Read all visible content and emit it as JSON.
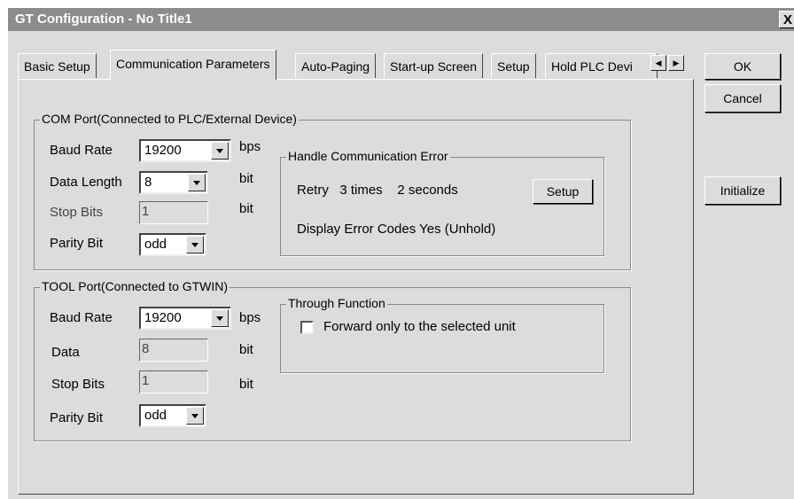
{
  "window": {
    "title": "GT Configuration - No Title1",
    "close_label": "X"
  },
  "tabs": [
    {
      "label": "Basic Setup"
    },
    {
      "label": "Communication Parameters"
    },
    {
      "label": "Auto-Paging"
    },
    {
      "label": "Start-up Screen"
    },
    {
      "label": "Setup"
    },
    {
      "label": "Hold PLC Devi"
    }
  ],
  "tab_scroll": {
    "left": "◀",
    "right": "▶"
  },
  "buttons": {
    "ok": "OK",
    "cancel": "Cancel",
    "initialize": "Initialize"
  },
  "com_port": {
    "legend": "COM Port(Connected to PLC/External Device)",
    "baud_rate": {
      "label": "Baud Rate",
      "value": "19200",
      "unit": "bps"
    },
    "data_length": {
      "label": "Data Length",
      "value": "8",
      "unit": "bit"
    },
    "stop_bits": {
      "label": "Stop Bits",
      "value": "1",
      "unit": "bit"
    },
    "parity_bit": {
      "label": "Parity Bit",
      "value": "odd"
    }
  },
  "comm_error": {
    "legend": "Handle Communication Error",
    "retry": "Retry   3 times    2 seconds",
    "setup_button": "Setup",
    "display_error": "Display Error Codes  Yes (Unhold)"
  },
  "tool_port": {
    "legend": "TOOL Port(Connected to GTWIN)",
    "baud_rate": {
      "label": "Baud Rate",
      "value": "19200",
      "unit": "bps"
    },
    "data": {
      "label": "Data",
      "value": "8",
      "unit": "bit"
    },
    "stop_bits": {
      "label": "Stop Bits",
      "value": "1",
      "unit": "bit"
    },
    "parity_bit": {
      "label": "Parity Bit",
      "value": "odd"
    }
  },
  "through_function": {
    "legend": "Through Function",
    "forward_label": "Forward only to the selected unit",
    "forward_checked": false
  }
}
